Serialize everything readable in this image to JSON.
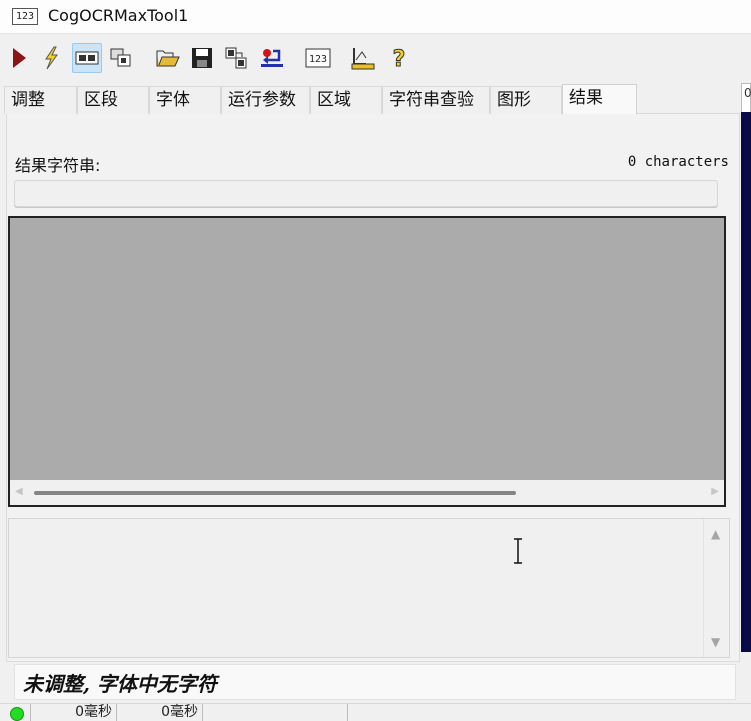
{
  "window": {
    "title": "CogOCRMaxTool1",
    "app_icon_text": "123"
  },
  "toolbar": {
    "buttons": [
      {
        "name": "run-icon",
        "color": "#8b1414"
      },
      {
        "name": "electric-icon",
        "color": "#e8c020"
      },
      {
        "name": "display-toggle-icon",
        "active": true
      },
      {
        "name": "local-display-icon"
      },
      {
        "name": "open-icon",
        "color": "#d9a520"
      },
      {
        "name": "save-icon"
      },
      {
        "name": "export-icon"
      },
      {
        "name": "reset-icon",
        "color": "#cc1111"
      },
      {
        "name": "ocr-icon",
        "text": "123"
      },
      {
        "name": "tune-icon"
      },
      {
        "name": "help-icon",
        "color": "#e8c020"
      }
    ]
  },
  "tabs": [
    {
      "label": "调整"
    },
    {
      "label": "区段"
    },
    {
      "label": "字体"
    },
    {
      "label": "运行参数"
    },
    {
      "label": "区域"
    },
    {
      "label": "字符串查验"
    },
    {
      "label": "图形"
    },
    {
      "label": "结果",
      "selected": true
    }
  ],
  "right_tab_label": "0",
  "result": {
    "label": "结果字符串:",
    "char_count": "0 characters",
    "value": ""
  },
  "status_message": "未调整, 字体中无字符",
  "statusbar": {
    "led_color": "#22dd22",
    "time1": "0毫秒",
    "time2": "0毫秒"
  },
  "colors": {
    "image_background": "#ababab",
    "right_strip": "#0a0a4a"
  }
}
